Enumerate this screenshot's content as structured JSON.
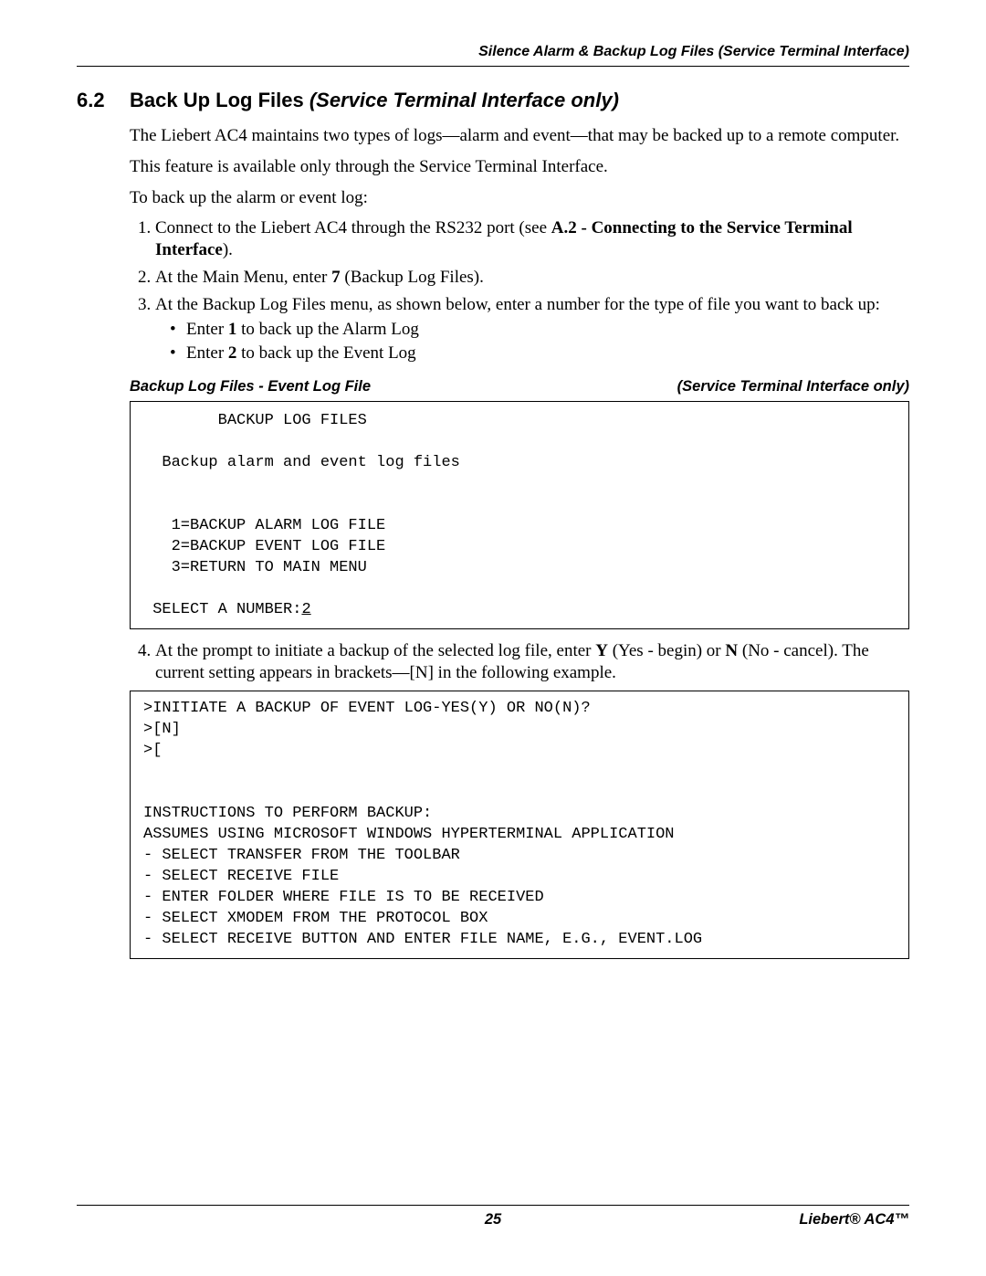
{
  "header": {
    "running": "Silence Alarm & Backup Log Files (Service Terminal Interface)"
  },
  "section": {
    "number": "6.2",
    "title_plain": "Back Up Log Files ",
    "title_ital": "(Service Terminal Interface only)"
  },
  "para1": "The Liebert AC4 maintains two types of logs—alarm and event—that may be backed up to a remote computer.",
  "para2": "This feature is available only through the Service Terminal Interface.",
  "para3": "To back up the alarm or event log:",
  "step1": {
    "a": "Connect to the Liebert AC4 through the RS232 port (see ",
    "b": "A.2 - Connecting to the Service Terminal Interface",
    "c": ")."
  },
  "step2": {
    "a": "At the Main Menu, enter ",
    "b": "7",
    "c": " (Backup Log Files)."
  },
  "step3": "At the Backup Log Files menu, as shown below, enter a number for the type of file you want to back up:",
  "bullet1": {
    "a": "Enter ",
    "b": "1",
    "c": " to back up the Alarm Log"
  },
  "bullet2": {
    "a": "Enter ",
    "b": "2",
    "c": " to back up the Event Log"
  },
  "caption": {
    "left": "Backup Log Files - Event Log File",
    "right": "(Service Terminal Interface only)"
  },
  "terminal1": {
    "l1": "        BACKUP LOG FILES",
    "l2": "",
    "l3": "  Backup alarm and event log files",
    "l4": "",
    "l5": "",
    "l6": "   1=BACKUP ALARM LOG FILE",
    "l7": "   2=BACKUP EVENT LOG FILE",
    "l8": "   3=RETURN TO MAIN MENU",
    "l9": "",
    "l10a": " SELECT A NUMBER:",
    "l10b": "2"
  },
  "step4": {
    "a": "At the prompt to initiate a backup of the selected log file, enter ",
    "b": "Y",
    "c": " (Yes - begin) or ",
    "d": "N",
    "e": " (No - cancel). The current setting appears in brackets—[N] in the following example."
  },
  "terminal2": {
    "l1": ">INITIATE A BACKUP OF EVENT LOG-YES(Y) OR NO(N)?",
    "l2": ">[N]",
    "l3": ">[",
    "l4": "",
    "l5": "",
    "l6": "INSTRUCTIONS TO PERFORM BACKUP:",
    "l7": "ASSUMES USING MICROSOFT WINDOWS HYPERTERMINAL APPLICATION",
    "l8": "- SELECT TRANSFER FROM THE TOOLBAR",
    "l9": "- SELECT RECEIVE FILE",
    "l10": "- ENTER FOLDER WHERE FILE IS TO BE RECEIVED",
    "l11": "- SELECT XMODEM FROM THE PROTOCOL BOX",
    "l12": "- SELECT RECEIVE BUTTON AND ENTER FILE NAME, E.G., EVENT.LOG"
  },
  "footer": {
    "page": "25",
    "product": "Liebert® AC4™"
  }
}
